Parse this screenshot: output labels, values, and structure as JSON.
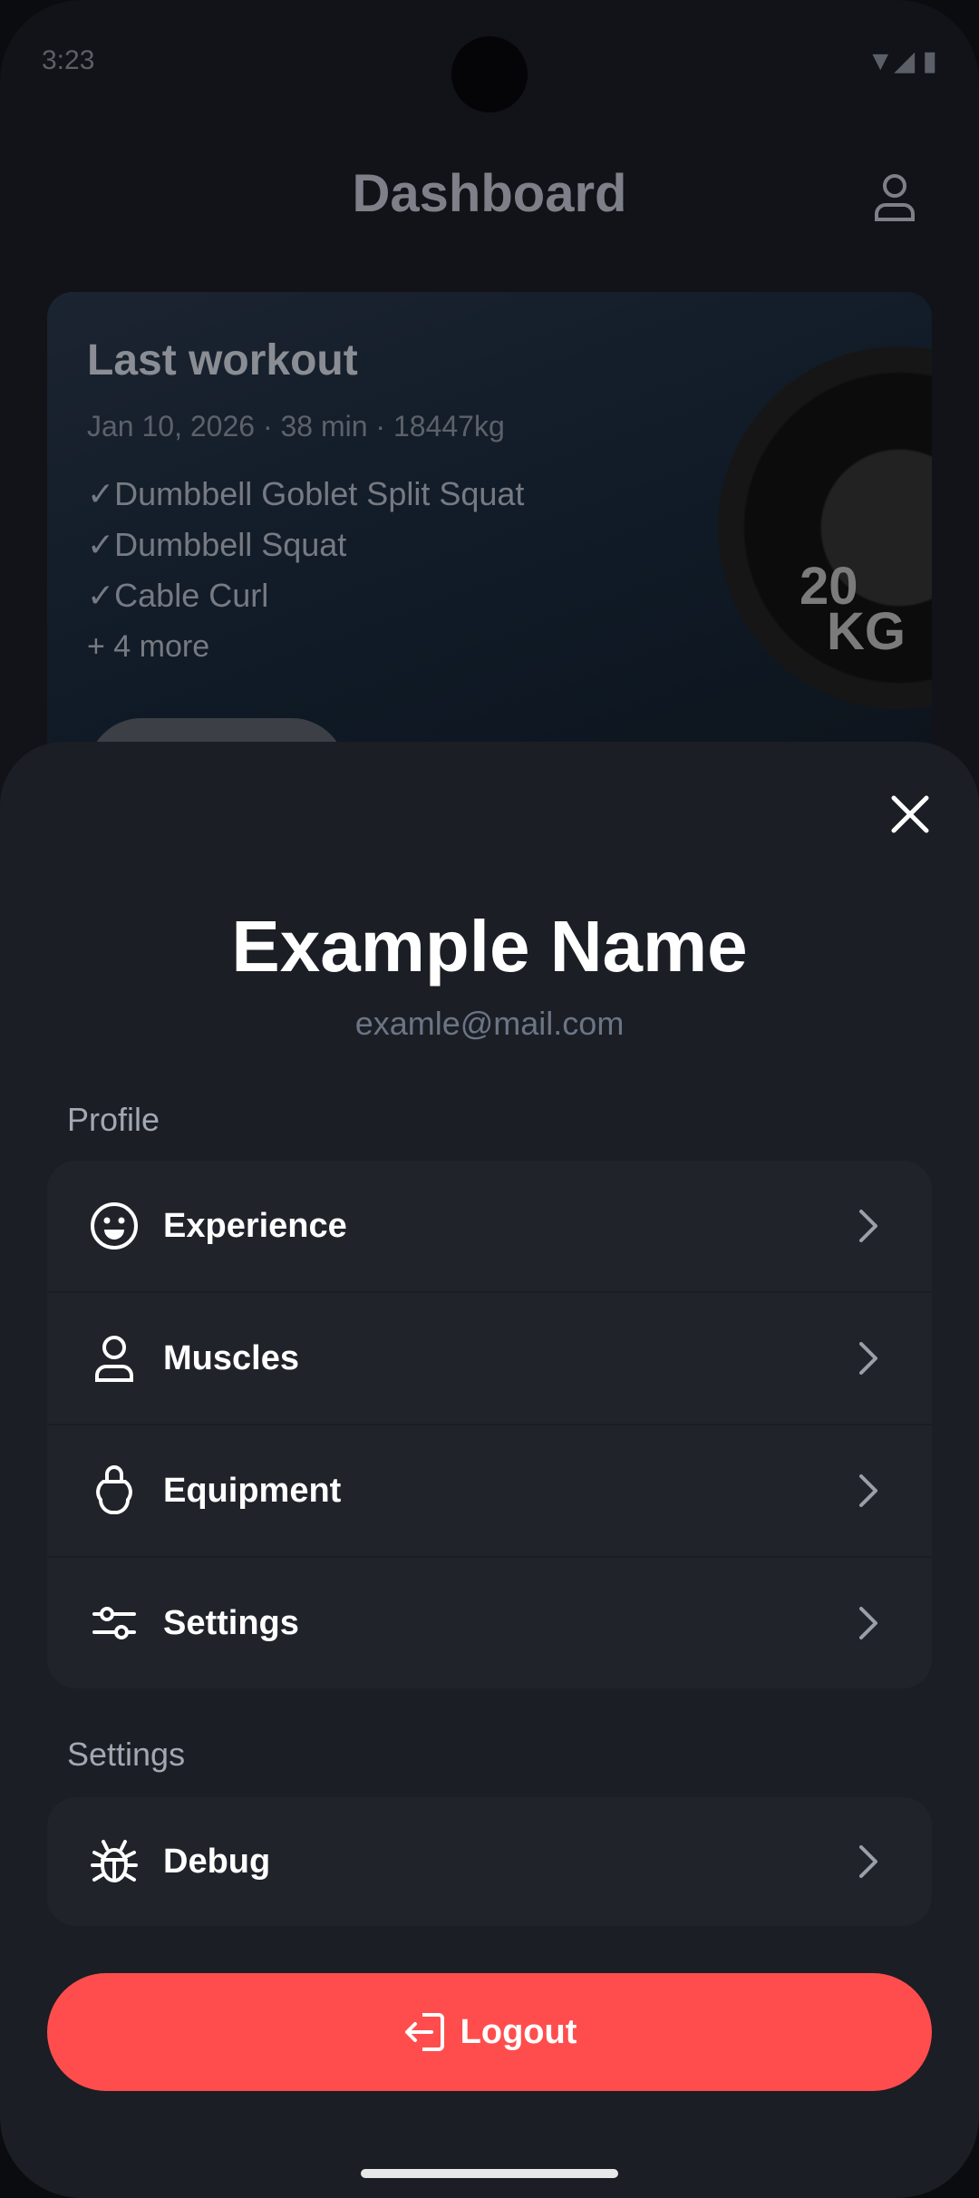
{
  "status": {
    "time": "3:23",
    "right": "▼◢ ▮"
  },
  "dashboard": {
    "title": "Dashboard",
    "last_workout": {
      "title": "Last workout",
      "meta": "Jan 10, 2026 · 38 min · 18447kg",
      "exercises": [
        "✓Dumbbell Goblet Split Squat",
        "✓Dumbbell Squat",
        "✓Cable Curl"
      ],
      "more": "+ 4 more",
      "plate_label_1": "20",
      "plate_label_2": "KG"
    }
  },
  "sheet": {
    "name": "Example Name",
    "email": "examle@mail.com",
    "profile_section": "Profile",
    "profile_items": [
      {
        "label": "Experience",
        "icon": "smiley-icon"
      },
      {
        "label": "Muscles",
        "icon": "person-icon"
      },
      {
        "label": "Equipment",
        "icon": "kettlebell-icon"
      },
      {
        "label": "Settings",
        "icon": "sliders-icon"
      }
    ],
    "settings_section": "Settings",
    "settings_items": [
      {
        "label": "Debug",
        "icon": "bug-icon"
      }
    ],
    "logout_label": "Logout"
  },
  "colors": {
    "sheet_bg": "#1b1e24",
    "row_bg": "#20232a",
    "logout": "#ff4d4d",
    "accent_text": "#6b7586"
  }
}
